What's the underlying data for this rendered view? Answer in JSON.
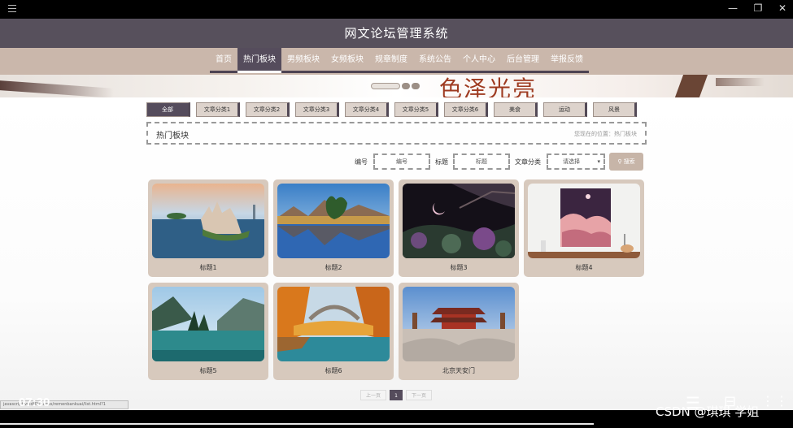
{
  "window": {
    "menu_icon": "hamburger-icon",
    "minimize": "—",
    "restore": "❐",
    "close": "✕"
  },
  "app_title": "网文论坛管理系统",
  "nav": {
    "items": [
      "首页",
      "热门板块",
      "男频板块",
      "女频板块",
      "规章制度",
      "系统公告",
      "个人中心",
      "后台管理",
      "举报反馈"
    ],
    "active_index": 1
  },
  "banner": {
    "deco_text": "色泽光亮"
  },
  "categories": {
    "items": [
      "全部",
      "文章分类1",
      "文章分类2",
      "文章分类3",
      "文章分类4",
      "文章分类5",
      "文章分类6",
      "美食",
      "运动",
      "风景"
    ],
    "active_index": 0
  },
  "breadcrumb": {
    "title": "热门板块",
    "location": "您现在的位置：热门板块"
  },
  "search": {
    "label_number": "编号",
    "placeholder_number": "编号",
    "label_title": "标题",
    "placeholder_title": "标题",
    "label_category": "文章分类",
    "select_value": "请选择",
    "button_label": "搜索"
  },
  "cards": [
    {
      "caption": "标题1"
    },
    {
      "caption": "标题2"
    },
    {
      "caption": "标题3"
    },
    {
      "caption": "标题4"
    },
    {
      "caption": "标题5"
    },
    {
      "caption": "标题6"
    },
    {
      "caption": "北京天安门"
    }
  ],
  "pagination": {
    "prev": "上一页",
    "current": "1",
    "next": "下一页"
  },
  "overlay": {
    "time": "07:30",
    "url": "javascript:void(0)/pages/remenbankuai/list.html?1",
    "watermark": "CSDN @琪琪 学姐"
  },
  "colors": {
    "header": "#57505c",
    "nav": "#cab7ab",
    "accent_dark": "#554c5c",
    "card_bg": "#d7c9bd"
  }
}
